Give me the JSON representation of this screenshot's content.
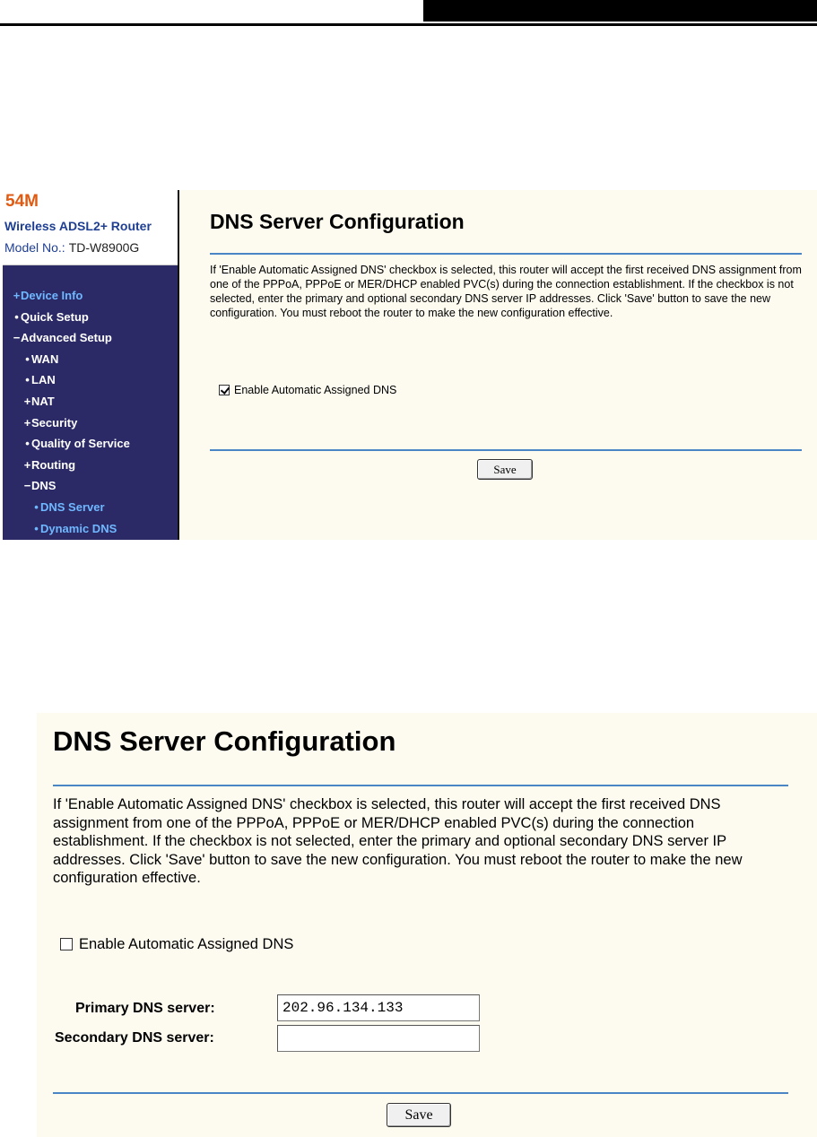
{
  "screenshot1": {
    "brand": {
      "speed": "54M",
      "product": "Wireless ADSL2+ Router",
      "model_label": "Model No.:",
      "model_value": "TD-W8900G"
    },
    "nav": [
      {
        "marker": "+",
        "label": "Device Info"
      },
      {
        "marker": "•",
        "label": "Quick Setup"
      },
      {
        "marker": "−",
        "label": "Advanced Setup"
      },
      {
        "marker": "•",
        "label": "WAN"
      },
      {
        "marker": "•",
        "label": "LAN"
      },
      {
        "marker": "+",
        "label": "NAT"
      },
      {
        "marker": "+",
        "label": "Security"
      },
      {
        "marker": "•",
        "label": "Quality of Service"
      },
      {
        "marker": "+",
        "label": "Routing"
      },
      {
        "marker": "−",
        "label": "DNS"
      },
      {
        "marker": "•",
        "label": "DNS Server"
      },
      {
        "marker": "•",
        "label": "Dynamic DNS"
      }
    ],
    "title": "DNS Server Configuration",
    "description": "If 'Enable Automatic Assigned DNS' checkbox is selected, this router will accept the first received DNS assignment from one of the PPPoA, PPPoE or MER/DHCP enabled PVC(s) during the connection establishment. If the checkbox is not selected, enter the primary and optional secondary DNS server IP addresses. Click 'Save' button to save the new configuration. You must reboot the router to make the new configuration effective.",
    "checkbox_label": "Enable Automatic Assigned DNS",
    "checkbox_checked": true,
    "save_label": "Save"
  },
  "screenshot2": {
    "title": "DNS Server Configuration",
    "description": "If 'Enable Automatic Assigned DNS' checkbox is selected, this router will accept the first received DNS assignment from one of the PPPoA, PPPoE or MER/DHCP enabled PVC(s) during the connection establishment. If the checkbox is not selected, enter the primary and optional secondary DNS server IP addresses. Click 'Save' button to save the new configuration. You must reboot the router to make the new configuration effective.",
    "checkbox_label": "Enable Automatic Assigned DNS",
    "checkbox_checked": false,
    "primary_label": "Primary DNS server:",
    "primary_value": "202.96.134.133",
    "secondary_label": "Secondary DNS server:",
    "secondary_value": "",
    "save_label": "Save"
  },
  "colors": {
    "nav_background": "#2b2a66",
    "nav_text": "#ffffff",
    "nav_active": "#6fb8ff",
    "brand_orange": "#e05a12",
    "brand_blue": "#1f3f93",
    "rule_blue": "#4a86c5",
    "panel_background": "#fdfbf0"
  }
}
